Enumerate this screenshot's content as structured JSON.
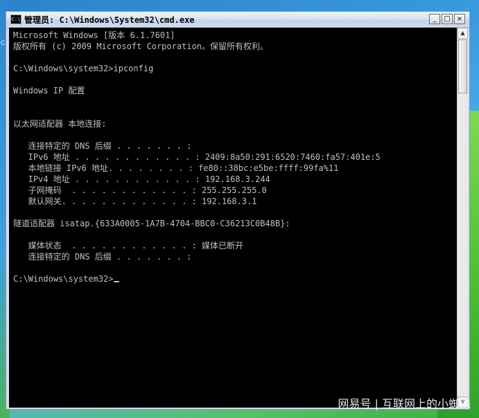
{
  "window": {
    "title": "管理员: C:\\Windows\\System32\\cmd.exe",
    "icon": "cmd-icon",
    "minimize_label": "_",
    "maximize_label": "□",
    "close_label": "×"
  },
  "console": {
    "lines": [
      "Microsoft Windows [版本 6.1.7601]",
      "版权所有 (c) 2009 Microsoft Corporation。保留所有权利。",
      "",
      "C:\\Windows\\system32>ipconfig",
      "",
      "Windows IP 配置",
      "",
      "",
      "以太网适配器 本地连接:",
      "",
      "   连接特定的 DNS 后缀 . . . . . . . :",
      "   IPv6 地址 . . . . . . . . . . . . : 2409:8a50:291:6520:7460:fa57:401e:5",
      "   本地链接 IPv6 地址. . . . . . . . : fe80::38bc:e5be:ffff:99fa%11",
      "   IPv4 地址 . . . . . . . . . . . . : 192.168.3.244",
      "   子网掩码  . . . . . . . . . . . . : 255.255.255.0",
      "   默认网关. . . . . . . . . . . . . : 192.168.3.1",
      "",
      "隧道适配器 isatap.{633A0005-1A7B-4704-BBC0-C36213C0B48B}:",
      "",
      "   媒体状态  . . . . . . . . . . . . : 媒体已断开",
      "   连接特定的 DNS 后缀 . . . . . . . :",
      "",
      "C:\\Windows\\system32>"
    ]
  },
  "desktop": {
    "side_text": "Co"
  },
  "watermark": "网易号 | 互联网上的小蜘蛛"
}
